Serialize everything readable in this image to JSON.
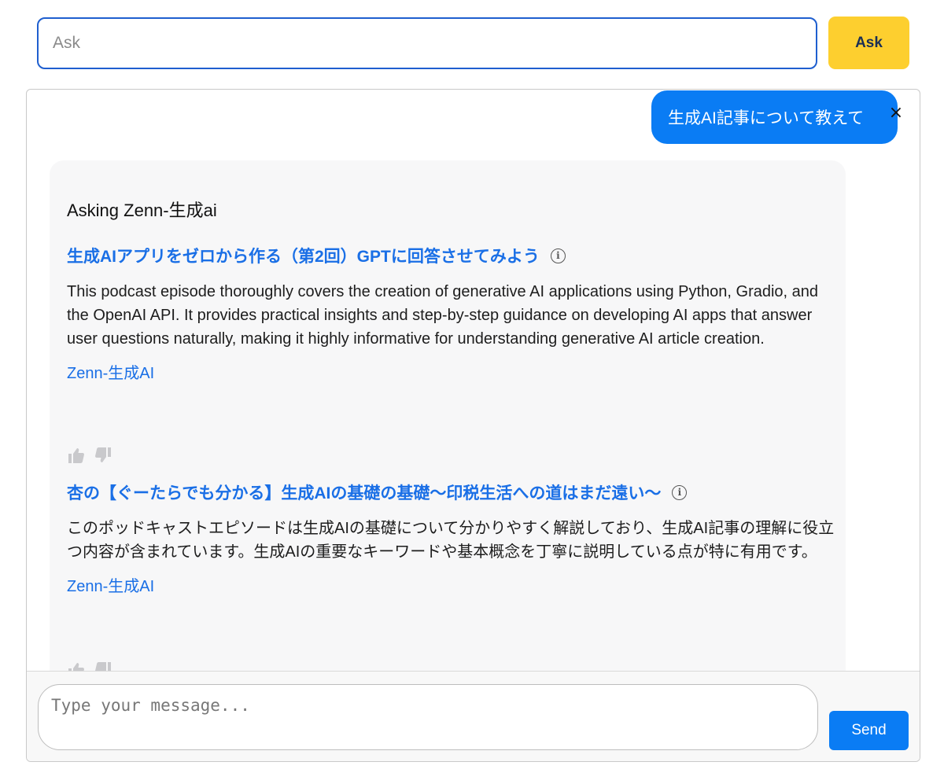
{
  "search": {
    "placeholder": "Ask",
    "button_label": "Ask"
  },
  "chat": {
    "user_message": "生成AI記事について教えて",
    "close_symbol": "×",
    "answer": {
      "heading": "Asking Zenn-生成ai",
      "results": [
        {
          "title": "生成AIアプリをゼロから作る（第2回）GPTに回答させてみよう",
          "description": "This podcast episode thoroughly covers the creation of generative AI applications using Python, Gradio, and the OpenAI API. It provides practical insights and step-by-step guidance on developing AI apps that answer user questions naturally, making it highly informative for understanding generative AI article creation.",
          "source": "Zenn-生成AI"
        },
        {
          "title": "杏の【ぐーたらでも分かる】生成AIの基礎の基礎〜印税生活への道はまだ遠い〜",
          "description": "このポッドキャストエピソードは生成AIの基礎について分かりやすく解説しており、生成AI記事の理解に役立つ内容が含まれています。生成AIの重要なキーワードや基本概念を丁寧に説明している点が特に有用です。",
          "source": "Zenn-生成AI"
        }
      ]
    }
  },
  "composer": {
    "placeholder": "Type your message...",
    "send_label": "Send"
  },
  "colors": {
    "accent_blue": "#0a7cf4",
    "link_blue": "#1a6fe6",
    "ask_yellow": "#fdcf2f",
    "card_bg": "#f7f7f8"
  },
  "icons": {
    "info": "info-icon",
    "thumbs_up": "thumbs-up-icon",
    "thumbs_down": "thumbs-down-icon",
    "close": "close-icon"
  }
}
